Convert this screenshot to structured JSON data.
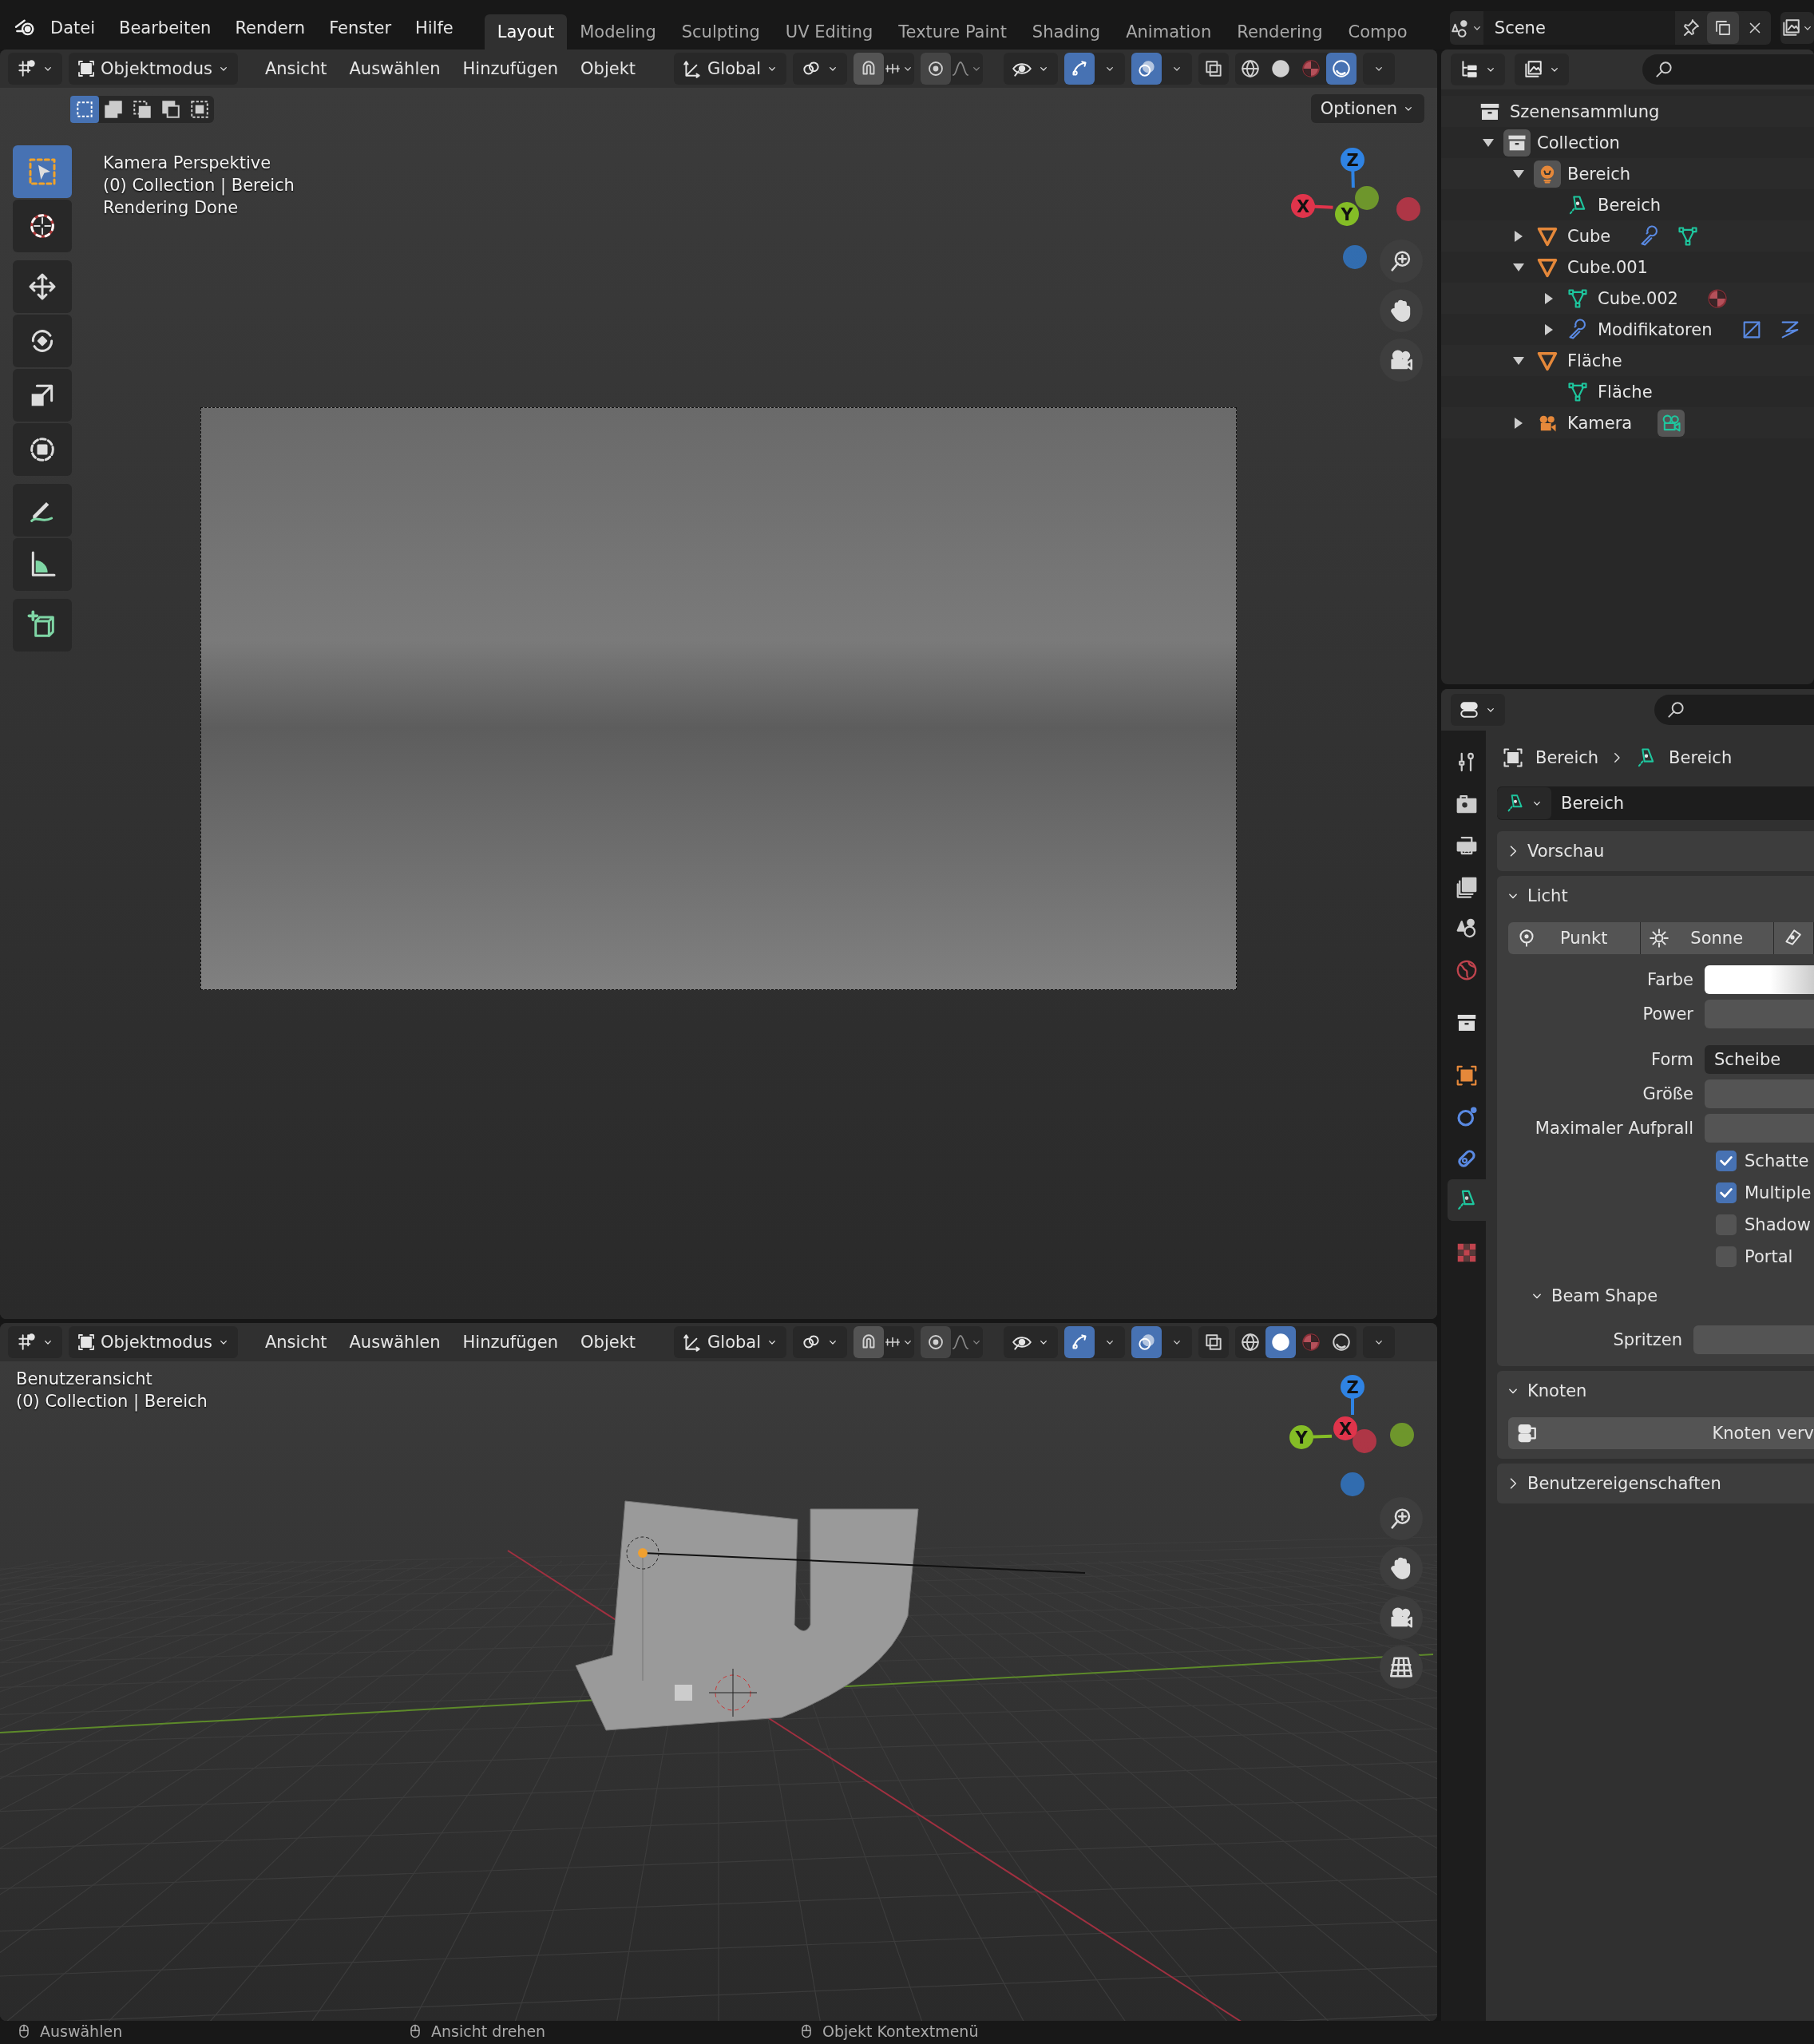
{
  "topbar": {
    "menus": [
      "Datei",
      "Bearbeiten",
      "Rendern",
      "Fenster",
      "Hilfe"
    ],
    "workspaces": [
      {
        "label": "Layout",
        "selected": true
      },
      {
        "label": "Modeling",
        "selected": false
      },
      {
        "label": "Sculpting",
        "selected": false
      },
      {
        "label": "UV Editing",
        "selected": false
      },
      {
        "label": "Texture Paint",
        "selected": false
      },
      {
        "label": "Shading",
        "selected": false
      },
      {
        "label": "Animation",
        "selected": false
      },
      {
        "label": "Rendering",
        "selected": false
      },
      {
        "label": "Compo",
        "selected": false
      }
    ],
    "scene": "Scene"
  },
  "viewports": [
    {
      "kind": "camera",
      "header": {
        "mode": "Objektmodus",
        "menus": [
          "Ansicht",
          "Auswählen",
          "Hinzufügen",
          "Objekt"
        ],
        "orientation": "Global",
        "toggles": [
          {
            "kind": "gizmo",
            "on": true
          },
          {
            "kind": "overlay",
            "on": true
          },
          {
            "kind": "xray",
            "on": false
          }
        ],
        "shading": [
          {
            "kind": "wireframe",
            "selected": false
          },
          {
            "kind": "solid",
            "selected": false
          },
          {
            "kind": "material",
            "selected": false
          },
          {
            "kind": "rendered",
            "selected": true
          }
        ]
      },
      "selection_modes": [
        {
          "selected": true
        },
        {
          "selected": false
        },
        {
          "selected": false
        },
        {
          "selected": false
        },
        {
          "selected": false
        }
      ],
      "options": "Optionen",
      "tools": [
        {
          "kind": "select",
          "selected": true
        },
        {
          "kind": "cursor",
          "selected": false
        },
        {
          "kind": "move",
          "selected": false
        },
        {
          "kind": "rotate",
          "selected": false
        },
        {
          "kind": "scale",
          "selected": false
        },
        {
          "kind": "transform",
          "selected": false
        },
        {
          "kind": "annotate",
          "selected": false
        },
        {
          "kind": "measure",
          "selected": false
        },
        {
          "kind": "add_cube",
          "selected": false
        }
      ],
      "info": [
        "Kamera Perspektive",
        "(0) Collection | Bereich",
        "Rendering Done"
      ],
      "gizmo": [
        {
          "label": "Z",
          "color": "#2f83e3"
        },
        {
          "label": "X",
          "color": "#e0344b"
        },
        {
          "label": "Y",
          "color": "#84bd26"
        }
      ],
      "nav_buttons": [
        {
          "kind": "zoom"
        },
        {
          "kind": "pan"
        },
        {
          "kind": "camera"
        }
      ]
    },
    {
      "kind": "user",
      "header": {
        "mode": "Objektmodus",
        "menus": [
          "Ansicht",
          "Auswählen",
          "Hinzufügen",
          "Objekt"
        ],
        "orientation": "Global",
        "toggles": [
          {
            "kind": "gizmo",
            "on": true
          },
          {
            "kind": "overlay",
            "on": true
          },
          {
            "kind": "xray",
            "on": false
          }
        ],
        "shading": [
          {
            "kind": "wireframe",
            "selected": false
          },
          {
            "kind": "solid",
            "selected": true
          },
          {
            "kind": "material",
            "selected": false
          },
          {
            "kind": "rendered",
            "selected": false
          }
        ]
      },
      "info": [
        "Benutzeransicht",
        "(0) Collection | Bereich"
      ],
      "gizmo": [
        {
          "label": "Z",
          "color": "#2f83e3"
        },
        {
          "label": "X",
          "color": "#e0344b"
        },
        {
          "label": "Y",
          "color": "#84bd26"
        }
      ],
      "nav_buttons": [
        {
          "kind": "zoom"
        },
        {
          "kind": "pan"
        },
        {
          "kind": "camera"
        },
        {
          "kind": "grid"
        }
      ]
    }
  ],
  "outliner": {
    "root": "Szenensammlung",
    "items": [
      {
        "label": "Collection",
        "kind": "collection",
        "expanded": true,
        "children": [
          {
            "label": "Bereich",
            "kind": "light_object",
            "expanded": true,
            "children": [
              {
                "label": "Bereich",
                "kind": "light_data"
              }
            ]
          },
          {
            "label": "Cube",
            "kind": "mesh_object",
            "expanded": false,
            "badges": [
              {
                "kind": "modifier"
              },
              {
                "kind": "mesh_data"
              }
            ]
          },
          {
            "label": "Cube.001",
            "kind": "mesh_object",
            "expanded": true,
            "children": [
              {
                "label": "Cube.002",
                "kind": "mesh_data",
                "expanded": false,
                "badges": [
                  {
                    "kind": "material"
                  }
                ]
              },
              {
                "label": "Modifikatoren",
                "kind": "modifier",
                "expanded": false,
                "badges": [
                  {
                    "kind": "lattice"
                  },
                  {
                    "kind": "hook"
                  }
                ]
              }
            ]
          },
          {
            "label": "Fläche",
            "kind": "mesh_object",
            "expanded": true,
            "children": [
              {
                "label": "Fläche",
                "kind": "mesh_data"
              }
            ]
          },
          {
            "label": "Kamera",
            "kind": "camera_object",
            "expanded": false,
            "badges": [
              {
                "kind": "camera_data"
              }
            ]
          }
        ]
      }
    ]
  },
  "properties": {
    "tabs": [
      {
        "kind": "tool",
        "selected": false
      },
      {
        "kind": "render",
        "selected": false
      },
      {
        "kind": "output",
        "selected": false
      },
      {
        "kind": "view_layer",
        "selected": false
      },
      {
        "kind": "scene",
        "selected": false
      },
      {
        "kind": "world",
        "selected": false
      },
      {
        "kind": "collection",
        "selected": false
      },
      {
        "kind": "object",
        "selected": false
      },
      {
        "kind": "physics",
        "selected": false
      },
      {
        "kind": "constraints",
        "selected": false
      },
      {
        "kind": "light_data",
        "selected": true
      },
      {
        "kind": "texture",
        "selected": false
      }
    ],
    "breadcrumb": [
      "Bereich",
      "Bereich"
    ],
    "datablock": "Bereich",
    "panels": [
      {
        "title": "Vorschau",
        "expanded": false
      },
      {
        "title": "Licht",
        "expanded": true,
        "light_types": [
          {
            "label": "Punkt",
            "kind": "point",
            "selected": false
          },
          {
            "label": "Sonne",
            "kind": "sun",
            "selected": false
          },
          {
            "kind": "spot",
            "selected": false
          }
        ],
        "fields": [
          {
            "kind": "color",
            "label": "Farbe"
          },
          {
            "kind": "number",
            "label": "Power"
          },
          {
            "kind": "dropdown",
            "label": "Form",
            "value": "Scheibe"
          },
          {
            "kind": "number",
            "label": "Größe"
          },
          {
            "kind": "number",
            "label": "Maximaler Aufprall"
          },
          {
            "kind": "checkbox",
            "label": "Schatte",
            "checked": true
          },
          {
            "kind": "checkbox",
            "label": "Multiple",
            "checked": true
          },
          {
            "kind": "checkbox",
            "label": "Shadow",
            "checked": false
          },
          {
            "kind": "checkbox",
            "label": "Portal",
            "checked": false
          }
        ],
        "subpanel": {
          "title": "Beam Shape",
          "expanded": true,
          "fields": [
            {
              "kind": "number",
              "label": "Spritzen"
            }
          ]
        }
      },
      {
        "title": "Knoten",
        "expanded": true,
        "button": "Knoten verv"
      },
      {
        "title": "Benutzereigenschaften",
        "expanded": false
      }
    ]
  },
  "status_bar": [
    "Auswählen",
    "Ansicht drehen",
    "Objekt Kontextmenü"
  ]
}
